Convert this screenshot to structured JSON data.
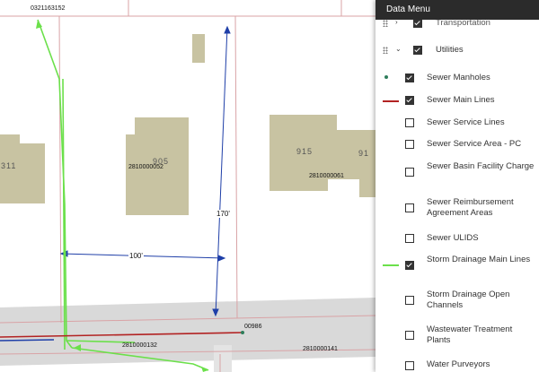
{
  "map": {
    "parcel_labels": [
      {
        "name": "parcel-id-0321163152",
        "text": "0321163152"
      },
      {
        "name": "parcel-id-2810000052",
        "text": "2810000052"
      },
      {
        "name": "parcel-id-2810000061",
        "text": "2810000061"
      },
      {
        "name": "parcel-id-2810000132",
        "text": "2810000132"
      },
      {
        "name": "parcel-id-2810000141",
        "text": "2810000141"
      },
      {
        "name": "manhole-id-00986",
        "text": "00986"
      }
    ],
    "building_numbers": [
      {
        "name": "building-number-311",
        "text": "311"
      },
      {
        "name": "building-number-905",
        "text": "905"
      },
      {
        "name": "building-number-915",
        "text": "915"
      },
      {
        "name": "building-number-91x",
        "text": "91"
      }
    ],
    "dimensions": [
      {
        "name": "dimension-100ft",
        "text": "100'"
      },
      {
        "name": "dimension-170ft",
        "text": "170'"
      }
    ],
    "colors": {
      "parcel_line": "#d9a3a6",
      "dimension_line": "#1f3fa8",
      "storm_drain": "#6be04a",
      "sewer_main": "#b22222",
      "manhole": "#2e7d5b",
      "building": "#c8c3a2",
      "road": "#d9d9d9"
    }
  },
  "panel": {
    "title": "Data Menu",
    "groups": [
      {
        "name": "transportation",
        "label": "Transportation",
        "checked": true
      },
      {
        "name": "utilities",
        "label": "Utilities",
        "checked": true
      }
    ],
    "layers": [
      {
        "name": "sewer-manholes",
        "label": "Sewer Manholes",
        "checked": true,
        "symbol": "dot"
      },
      {
        "name": "sewer-main-lines",
        "label": "Sewer Main Lines",
        "checked": true,
        "symbol": "red-line"
      },
      {
        "name": "sewer-service-lines",
        "label": "Sewer Service Lines",
        "checked": false,
        "symbol": ""
      },
      {
        "name": "sewer-service-area-pc",
        "label": "Sewer Service Area - PC",
        "checked": false,
        "symbol": ""
      },
      {
        "name": "sewer-basin-facility-charge",
        "label": "Sewer Basin Facility Charge",
        "checked": false,
        "symbol": ""
      },
      {
        "name": "sewer-reimbursement-agreement-areas",
        "label": "Sewer Reimbursement Agreement Areas",
        "checked": false,
        "symbol": ""
      },
      {
        "name": "sewer-ulids",
        "label": "Sewer ULIDS",
        "checked": false,
        "symbol": ""
      },
      {
        "name": "storm-drainage-main-lines",
        "label": "Storm Drainage Main Lines",
        "checked": true,
        "symbol": "green-line"
      },
      {
        "name": "storm-drainage-open-channels",
        "label": "Storm Drainage Open Channels",
        "checked": false,
        "symbol": ""
      },
      {
        "name": "wastewater-treatment-plants",
        "label": "Wastewater Treatment Plants",
        "checked": false,
        "symbol": ""
      },
      {
        "name": "water-purveyors",
        "label": "Water Purveyors",
        "checked": false,
        "symbol": ""
      }
    ]
  }
}
